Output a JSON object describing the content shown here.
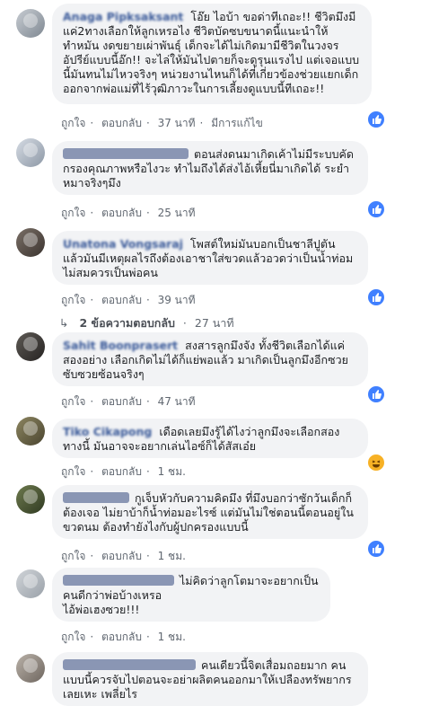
{
  "labels": {
    "like": "ถูกใจ",
    "reply": "ตอบกลับ",
    "edited": "มีการแก้ไข"
  },
  "comments": [
    {
      "name": "Anaga Pipksaksant",
      "text": "โอ๊ย ไอบ้า ขอด่าทีเถอะ!! ชีวิตมึงมีแค่2ทางเลือกให้ลูกเหรอไง ชีวิตบัดซบขนาดนี้แนะนำให้ทำหมัน งดขยายเผ่าพันธุ์ เด็กจะได้ไม่เกิดมามีชีวิตในวงจรอัปรีย์แบบนี้อ๊ก!! จะไล่ให้มันไปตายก็จะดูรุนแรงไป แต่เจอแบบนี้มันทนไม่ไหวจริงๆ หน่วยงานไหนก็ได้ที่เกี่ยวข้องช่วยแยกเด็กออกจากพ่อแม่ที่ไร้วุฒิภาวะในการเลี้ยงดูแบบนี้ทีเถอะ!!",
      "time": "37 นาที",
      "edited": true,
      "reaction": "like"
    },
    {
      "name": "",
      "text": "ตอนส่งดนมาเกิดเค้าไม่มีระบบคัดกรองคุณภาพหรือไงวะ ทำไมถึงได้ส่งไอ้เหี้ยนี่มาเกิดได้ ระยำหมาจริงๆมึง",
      "time": "25 นาที",
      "edited": false,
      "reaction": "like"
    },
    {
      "name": "Unatona Vongsaraj",
      "text": "โพสต์ใหม่มันบอกเป็นชาลีปูตัน แล้วมันมีเหตุผลไรถึงต้องเอาชาใส่ขวดแล้วอวดว่าเป็นน้ำท่อมไม่สมควรเป็นพ่อคน",
      "time": "39 นาที",
      "edited": false,
      "reaction": "like",
      "replies_label": "2 ข้อความตอบกลับ",
      "replies_time": "27 นาที"
    },
    {
      "name": "Sahit Boonprasert",
      "text": "สงสารลูกมึงจัง ทั้งชีวิตเลือกได้แค่สองอย่าง เลือกเกิดไม่ได้ก็แย่พอแล้ว มาเกิดเป็นลูกมึงอีกซวยซับซวยซ้อนจริงๆ",
      "time": "47 นาที",
      "edited": false,
      "reaction": "like"
    },
    {
      "name": "Tiko Cikapong",
      "text": "เดือดเลยมึงรู้ได้ไงว่าลูกมึงจะเลือกสองทางนี้ มันอาจจะอยากเล่นไอซ์ก็ได้สัสเอ๋ย",
      "time": "1 ชม.",
      "edited": false,
      "reaction": "haha"
    },
    {
      "name": "",
      "text": "กูเจ็บหัวกับความคิดมึง ที่มึงบอกว่าซักวันเด็กก็ต้องเจอ ไม่ยาบ้าก็น้ำท่อมอะไรซ์ แต่มันไม่ใช่ตอนนี้ตอนอยู่ในขวดนม ต้องทำยังไงกับผู้ปกครองแบบนี้",
      "time": "1 ชม.",
      "edited": false,
      "reaction": "like"
    },
    {
      "name": "",
      "text": "ไม่คิดว่าลูกโตมาจะอยากเป็นคนดีกว่าพ่อบ้างเหรอ\nไอ้พ่อเฮงซวย!!!",
      "time": "1 ชม.",
      "edited": false,
      "reaction": "none"
    },
    {
      "name": "",
      "text": "คนเดียวนี้จิตเสื่อมถอยมาก คนแบบนี้ควรจับไปตอนจะอย่าผลิตคนออกมาให้เปลืองทรัพยากรเลยเหะ เพลี่ยไร",
      "time": "",
      "edited": false,
      "reaction": "none"
    }
  ]
}
